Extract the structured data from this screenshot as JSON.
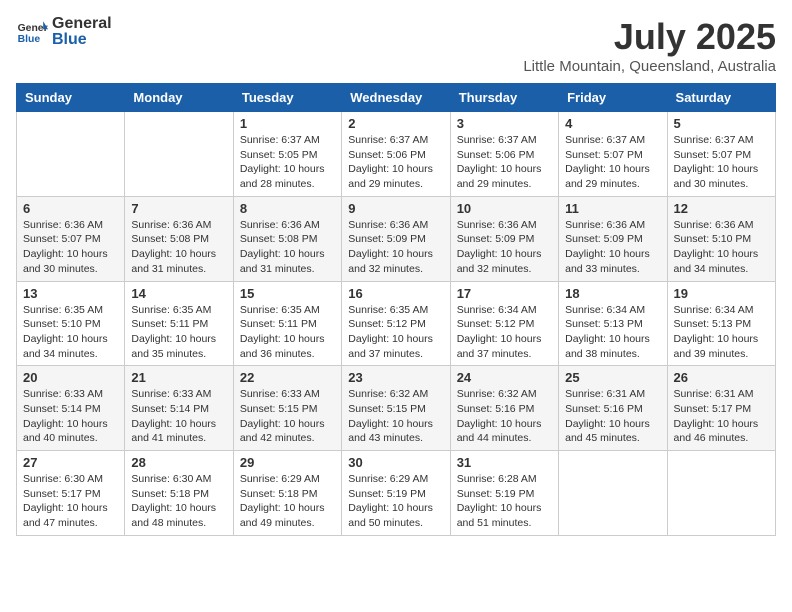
{
  "header": {
    "logo_general": "General",
    "logo_blue": "Blue",
    "month_year": "July 2025",
    "location": "Little Mountain, Queensland, Australia"
  },
  "days_of_week": [
    "Sunday",
    "Monday",
    "Tuesday",
    "Wednesday",
    "Thursday",
    "Friday",
    "Saturday"
  ],
  "weeks": [
    [
      {
        "day": "",
        "info": ""
      },
      {
        "day": "",
        "info": ""
      },
      {
        "day": "1",
        "info": "Sunrise: 6:37 AM\nSunset: 5:05 PM\nDaylight: 10 hours and 28 minutes."
      },
      {
        "day": "2",
        "info": "Sunrise: 6:37 AM\nSunset: 5:06 PM\nDaylight: 10 hours and 29 minutes."
      },
      {
        "day": "3",
        "info": "Sunrise: 6:37 AM\nSunset: 5:06 PM\nDaylight: 10 hours and 29 minutes."
      },
      {
        "day": "4",
        "info": "Sunrise: 6:37 AM\nSunset: 5:07 PM\nDaylight: 10 hours and 29 minutes."
      },
      {
        "day": "5",
        "info": "Sunrise: 6:37 AM\nSunset: 5:07 PM\nDaylight: 10 hours and 30 minutes."
      }
    ],
    [
      {
        "day": "6",
        "info": "Sunrise: 6:36 AM\nSunset: 5:07 PM\nDaylight: 10 hours and 30 minutes."
      },
      {
        "day": "7",
        "info": "Sunrise: 6:36 AM\nSunset: 5:08 PM\nDaylight: 10 hours and 31 minutes."
      },
      {
        "day": "8",
        "info": "Sunrise: 6:36 AM\nSunset: 5:08 PM\nDaylight: 10 hours and 31 minutes."
      },
      {
        "day": "9",
        "info": "Sunrise: 6:36 AM\nSunset: 5:09 PM\nDaylight: 10 hours and 32 minutes."
      },
      {
        "day": "10",
        "info": "Sunrise: 6:36 AM\nSunset: 5:09 PM\nDaylight: 10 hours and 32 minutes."
      },
      {
        "day": "11",
        "info": "Sunrise: 6:36 AM\nSunset: 5:09 PM\nDaylight: 10 hours and 33 minutes."
      },
      {
        "day": "12",
        "info": "Sunrise: 6:36 AM\nSunset: 5:10 PM\nDaylight: 10 hours and 34 minutes."
      }
    ],
    [
      {
        "day": "13",
        "info": "Sunrise: 6:35 AM\nSunset: 5:10 PM\nDaylight: 10 hours and 34 minutes."
      },
      {
        "day": "14",
        "info": "Sunrise: 6:35 AM\nSunset: 5:11 PM\nDaylight: 10 hours and 35 minutes."
      },
      {
        "day": "15",
        "info": "Sunrise: 6:35 AM\nSunset: 5:11 PM\nDaylight: 10 hours and 36 minutes."
      },
      {
        "day": "16",
        "info": "Sunrise: 6:35 AM\nSunset: 5:12 PM\nDaylight: 10 hours and 37 minutes."
      },
      {
        "day": "17",
        "info": "Sunrise: 6:34 AM\nSunset: 5:12 PM\nDaylight: 10 hours and 37 minutes."
      },
      {
        "day": "18",
        "info": "Sunrise: 6:34 AM\nSunset: 5:13 PM\nDaylight: 10 hours and 38 minutes."
      },
      {
        "day": "19",
        "info": "Sunrise: 6:34 AM\nSunset: 5:13 PM\nDaylight: 10 hours and 39 minutes."
      }
    ],
    [
      {
        "day": "20",
        "info": "Sunrise: 6:33 AM\nSunset: 5:14 PM\nDaylight: 10 hours and 40 minutes."
      },
      {
        "day": "21",
        "info": "Sunrise: 6:33 AM\nSunset: 5:14 PM\nDaylight: 10 hours and 41 minutes."
      },
      {
        "day": "22",
        "info": "Sunrise: 6:33 AM\nSunset: 5:15 PM\nDaylight: 10 hours and 42 minutes."
      },
      {
        "day": "23",
        "info": "Sunrise: 6:32 AM\nSunset: 5:15 PM\nDaylight: 10 hours and 43 minutes."
      },
      {
        "day": "24",
        "info": "Sunrise: 6:32 AM\nSunset: 5:16 PM\nDaylight: 10 hours and 44 minutes."
      },
      {
        "day": "25",
        "info": "Sunrise: 6:31 AM\nSunset: 5:16 PM\nDaylight: 10 hours and 45 minutes."
      },
      {
        "day": "26",
        "info": "Sunrise: 6:31 AM\nSunset: 5:17 PM\nDaylight: 10 hours and 46 minutes."
      }
    ],
    [
      {
        "day": "27",
        "info": "Sunrise: 6:30 AM\nSunset: 5:17 PM\nDaylight: 10 hours and 47 minutes."
      },
      {
        "day": "28",
        "info": "Sunrise: 6:30 AM\nSunset: 5:18 PM\nDaylight: 10 hours and 48 minutes."
      },
      {
        "day": "29",
        "info": "Sunrise: 6:29 AM\nSunset: 5:18 PM\nDaylight: 10 hours and 49 minutes."
      },
      {
        "day": "30",
        "info": "Sunrise: 6:29 AM\nSunset: 5:19 PM\nDaylight: 10 hours and 50 minutes."
      },
      {
        "day": "31",
        "info": "Sunrise: 6:28 AM\nSunset: 5:19 PM\nDaylight: 10 hours and 51 minutes."
      },
      {
        "day": "",
        "info": ""
      },
      {
        "day": "",
        "info": ""
      }
    ]
  ]
}
